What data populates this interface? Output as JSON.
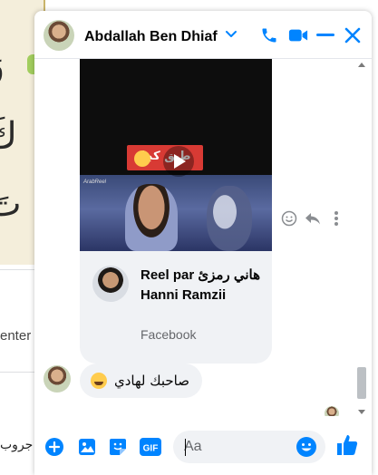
{
  "window": {
    "contact_name": "Abdallah Ben Dhiaf",
    "icons": {
      "chevron": "chevron-down-icon",
      "phone": "phone-icon",
      "video": "video-camera-icon",
      "minimize": "minimize-icon",
      "close": "close-icon"
    }
  },
  "background": {
    "quran_glyphs": [
      "وَ",
      "كَ",
      "تَ"
    ],
    "partial_text": "enter",
    "bottom_text": "جروب"
  },
  "reel": {
    "caption_text": "طبق كمِا",
    "title": "Reel par هاني رمزئ Hanni Ramzii",
    "source": "Facebook",
    "watermark": "ArabReel"
  },
  "messages": [
    {
      "text": "صاحبك لهادي",
      "emoji": "rofl"
    }
  ],
  "composer": {
    "placeholder": "Aa",
    "icons": [
      "plus-icon",
      "photo-icon",
      "sticker-icon",
      "gif-icon",
      "emoji-icon",
      "like-icon"
    ]
  },
  "colors": {
    "accent": "#0084ff",
    "bubble_bg": "#f0f2f5",
    "secondary_text": "#65676b"
  }
}
